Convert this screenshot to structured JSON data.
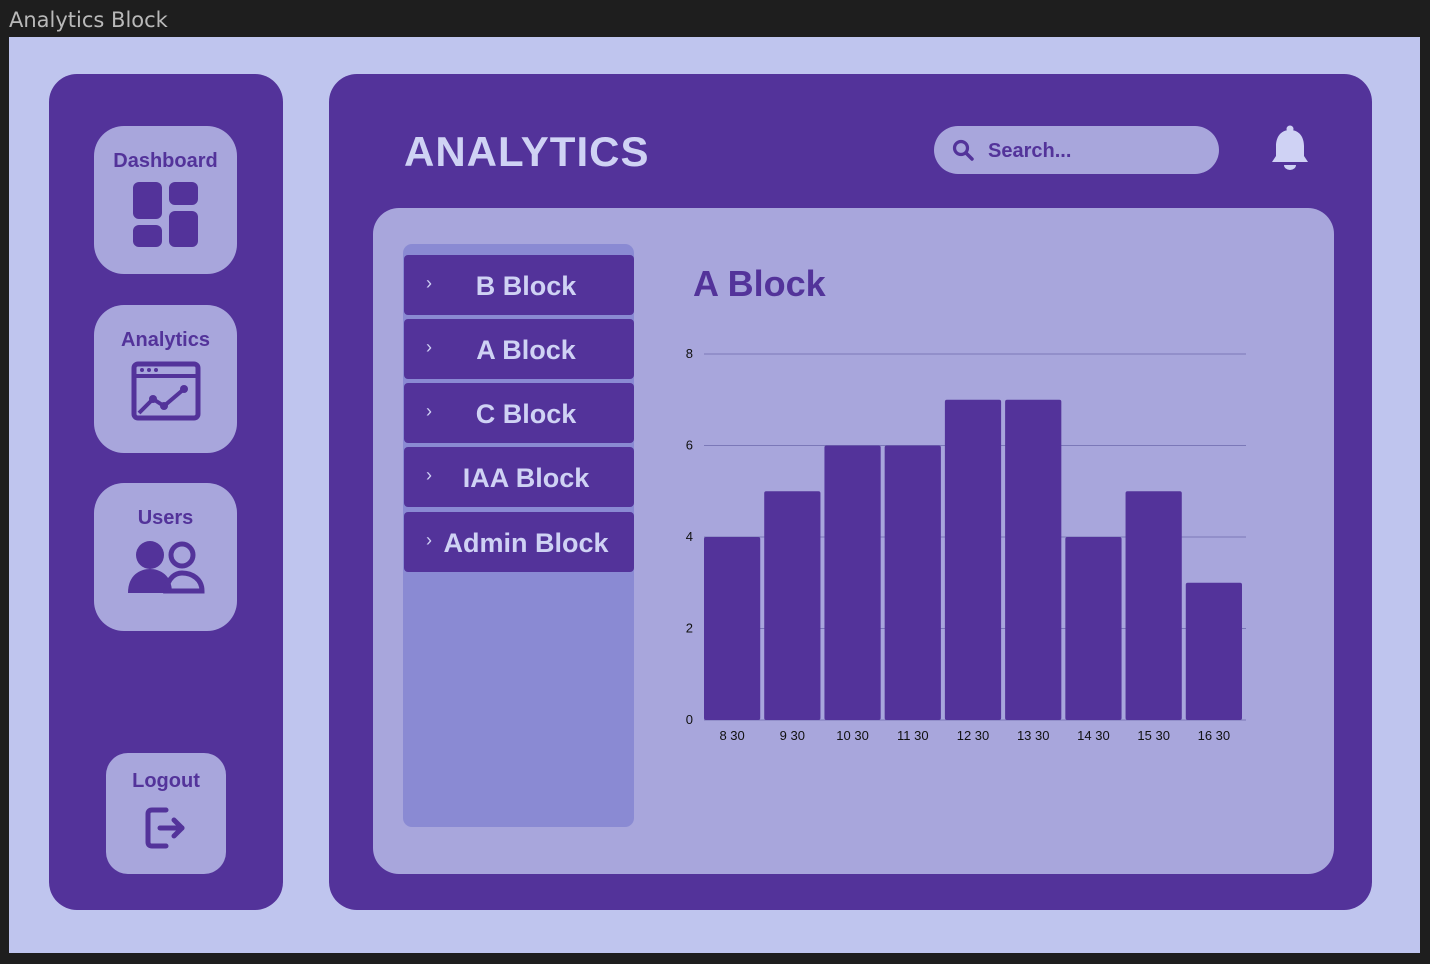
{
  "window": {
    "title": "Analytics Block"
  },
  "sidebar": {
    "items": [
      {
        "label": "Dashboard",
        "icon": "dashboard-grid-icon"
      },
      {
        "label": "Analytics",
        "icon": "analytics-chart-icon"
      },
      {
        "label": "Users",
        "icon": "users-icon"
      }
    ],
    "logout_label": "Logout"
  },
  "header": {
    "title": "ANALYTICS",
    "search_placeholder": "Search...",
    "notification_icon": "bell-icon"
  },
  "blocks": {
    "items": [
      {
        "label": "B Block"
      },
      {
        "label": "A Block"
      },
      {
        "label": "C Block"
      },
      {
        "label": "IAA Block"
      },
      {
        "label": "Admin Block"
      }
    ]
  },
  "colors": {
    "primary": "#53339a",
    "light": "#a8a6dc",
    "background": "#bfc5ee",
    "list_background": "#8a8ad3"
  },
  "chart_data": {
    "type": "bar",
    "title": "A Block",
    "categories": [
      "8 30",
      "9 30",
      "10 30",
      "11 30",
      "12 30",
      "13 30",
      "14 30",
      "15 30",
      "16 30"
    ],
    "values": [
      4,
      5,
      6,
      6,
      7,
      7,
      4,
      5,
      3
    ],
    "yticks": [
      0,
      2,
      4,
      6,
      8
    ],
    "ylim": [
      0,
      8
    ],
    "grid": true,
    "bar_color": "#53339a"
  }
}
